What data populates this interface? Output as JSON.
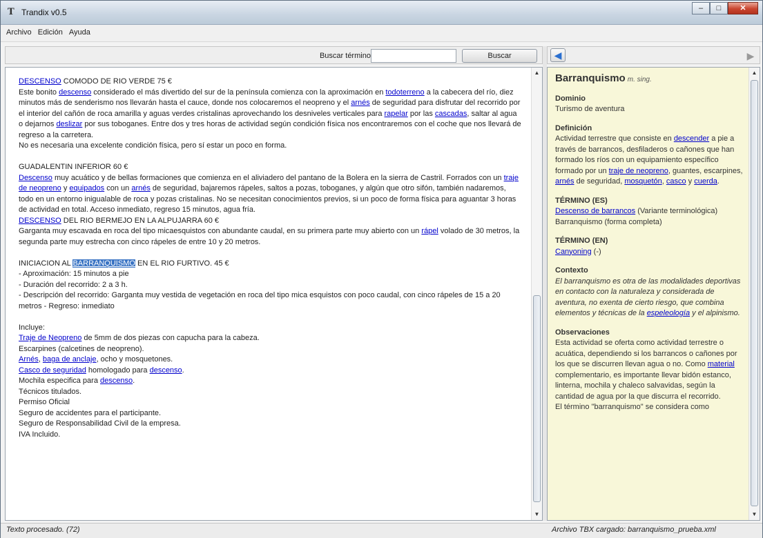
{
  "window": {
    "title": "Trandix v0.5",
    "icon": "T",
    "controls": {
      "minimize": "–",
      "maximize": "□",
      "close": "✕"
    }
  },
  "menu": [
    "Archivo",
    "Edición",
    "Ayuda"
  ],
  "search": {
    "label": "Buscar término:",
    "value": "",
    "button": "Buscar"
  },
  "doc": {
    "p1": {
      "t1": "DESCENSO",
      "t2": " COMODO DE RIO VERDE 75 €",
      "t3": "Este bonito ",
      "t4": "descenso",
      "t5": " considerado el más divertido del sur de la península comienza con la aproximación en ",
      "t6": "todoterreno",
      "t7": " a la cabecera del río, diez minutos más de senderismo nos llevarán hasta el cauce, donde nos colocaremos el neopreno y el ",
      "t8": "arnés",
      "t9": " de seguridad para disfrutar del recorrido por el interior del cañón de roca amarilla y aguas verdes cristalinas aprovechando los desniveles verticales para ",
      "t10": "rapelar",
      "t11": " por las ",
      "t12": "cascadas",
      "t13": ", saltar al agua o dejarnos ",
      "t14": "deslizar",
      "t15": " por sus toboganes. Entre dos y tres horas de actividad según condición física nos encontraremos con el coche que nos llevará de regreso a la carretera.",
      "t16": "No es necesaria una excelente condición física, pero sí estar un poco en forma."
    },
    "p2": {
      "t1": "GUADALENTIN INFERIOR 60 €",
      "t2": "Descenso",
      "t3": " muy acuático y de bellas formaciones que comienza en el aliviadero del pantano de la Bolera en la sierra de Castril. Forrados con un ",
      "t4": "traje de neopreno",
      "t5": " y ",
      "t6": "equipados",
      "t7": " con un ",
      "t8": "arnés",
      "t9": " de seguridad, bajaremos rápeles, saltos a pozas, toboganes, y algún que otro sifón, también nadaremos, todo en un entorno inigualable de roca y pozas cristalinas. No se necesitan conocimientos previos, si un poco de forma física para aguantar 3 horas de actividad en total. Acceso inmediato, regreso 15 minutos, agua fría."
    },
    "p3": {
      "t1": "DESCENSO",
      "t2": " DEL RIO BERMEJO EN LA ALPUJARRA 60 €",
      "t3": "Garganta muy escavada en roca del tipo micaesquistos con abundante caudal, en su primera parte muy abierto con un ",
      "t4": "rápel",
      "t5": " volado de 30 metros, la segunda parte muy estrecha con cinco rápeles de entre 10 y 20 metros."
    },
    "p4": {
      "t1": "INICIACION AL ",
      "t2": "BARRANQUISMO",
      "t3": " EN EL RIO FURTIVO. 45 €",
      "l1": "- Aproximación: 15 minutos a pie",
      "l2": "- Duración del recorrido: 2 a 3 h.",
      "l3": "- Descripción del recorrido: Garganta muy vestida de vegetación en roca del tipo mica esquistos con poco caudal, con cinco rápeles de 15 a 20 metros - Regreso: inmediato"
    },
    "p5": {
      "t1": "Incluye:",
      "a1": "Traje de Neopreno",
      "a2": " de 5mm de dos piezas con capucha para la cabeza.",
      "b1": "Escarpines (calcetines de neopreno).",
      "c1": "Arnés",
      "c2": ", ",
      "c3": "baga de anclaje",
      "c4": ", ocho y mosquetones.",
      "d1": "Casco de seguridad",
      "d2": " homologado para ",
      "d3": "descenso",
      "d4": ".",
      "e1": "Mochila especifica para ",
      "e2": "descenso",
      "e3": ".",
      "f1": "Técnicos titulados.",
      "g1": "Permiso Oficial",
      "h1": "Seguro de accidentes para el participante.",
      "i1": "Seguro de Responsabilidad Civil de la empresa.",
      "j1": "IVA Incluido."
    }
  },
  "term": {
    "title": "Barranquismo",
    "gram": "m. sing.",
    "dominio_h": "Dominio",
    "dominio": "Turismo de aventura",
    "def_h": "Definición",
    "def1": "Actividad terrestre que consiste en ",
    "def2": "descender",
    "def3": " a pie a través de barrancos, desfiladeros o cañones que han formado los ríos con un equipamiento específico formado por un ",
    "def4": "traje de neopreno",
    "def5": ", guantes, escarpines, ",
    "def6": "arnés",
    "def7": " de seguridad, ",
    "def8": "mosquetón",
    "def9": ", ",
    "def10": "casco",
    "def11": " y ",
    "def12": "cuerda",
    "def13": ".",
    "es_h": "TÉRMINO (ES)",
    "es1": "Descenso de barrancos",
    "es2": " (Variante terminológica)",
    "es3": "Barranquismo (forma completa)",
    "en_h": "TÉRMINO (EN)",
    "en1": "Canyoning",
    "en2": " (-)",
    "ctx_h": "Contexto",
    "ctx1": "El barranquismo es otra de las modalidades deportivas en contacto con la naturaleza y considerada de aventura, no exenta de cierto riesgo, que combina elementos y técnicas de la ",
    "ctx2": "espeleología",
    "ctx3": " y el alpinismo.",
    "obs_h": "Observaciones",
    "obs1": "Esta actividad se oferta como actividad terrestre o acuática, dependiendo si los barrancos o cañones por los que se discurren llevan agua o no. Como ",
    "obs2": "material",
    "obs3": " complementario, es importante llevar bidón estanco, linterna, mochila y chaleco salvavidas, según la cantidad de agua por la que discurra el recorrido.",
    "obs4": "El término \"barranquismo\" se considera como"
  },
  "status": {
    "left": "Texto procesado. (72)",
    "right": "Archivo TBX cargado: barranquismo_prueba.xml"
  },
  "nav": {
    "back_icon": "◀",
    "fwd_icon": "▶"
  },
  "colors": {
    "link": "#0000cc",
    "highlight": "#3a74c4",
    "term_bg": "#f8f7d9"
  }
}
